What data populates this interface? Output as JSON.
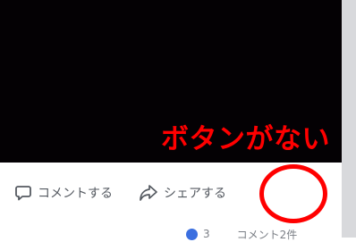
{
  "video": {
    "background_color": "#040104"
  },
  "annotation": {
    "text": "ボタンがない",
    "color": "#ff0000"
  },
  "actions": {
    "comment_label": "コメントする",
    "share_label": "シェアする"
  },
  "stats": {
    "like_count": "3",
    "comment_count": "コメント2件"
  }
}
